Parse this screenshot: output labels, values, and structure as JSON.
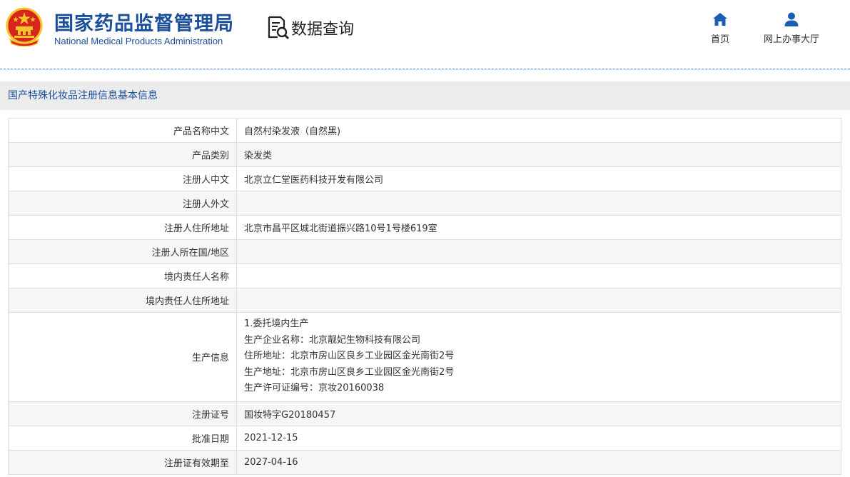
{
  "header": {
    "org_name_cn": "国家药品监督管理局",
    "org_name_en": "National Medical Products Administration",
    "query_label": "数据查询",
    "nav": [
      {
        "label": "首页",
        "icon": "home-icon"
      },
      {
        "label": "网上办事大厅",
        "icon": "user-icon"
      }
    ]
  },
  "section_title": "国产特殊化妆品注册信息基本信息",
  "rows": [
    {
      "label": "产品名称中文",
      "value": "自然村染发液（自然黑)"
    },
    {
      "label": "产品类别",
      "value": "染发类"
    },
    {
      "label": "注册人中文",
      "value": "北京立仁堂医药科技开发有限公司"
    },
    {
      "label": "注册人外文",
      "value": ""
    },
    {
      "label": "注册人住所地址",
      "value": "北京市昌平区城北街道振兴路10号1号楼619室"
    },
    {
      "label": "注册人所在国/地区",
      "value": ""
    },
    {
      "label": "境内责任人名称",
      "value": ""
    },
    {
      "label": "境内责任人住所地址",
      "value": ""
    },
    {
      "label": "生产信息",
      "lines": [
        "1.委托境内生产",
        "生产企业名称：北京靓妃生物科技有限公司",
        "住所地址：北京市房山区良乡工业园区金光南街2号",
        "生产地址：北京市房山区良乡工业园区金光南街2号",
        "生产许可证编号：京妆20160038"
      ]
    },
    {
      "label": "注册证号",
      "value": "国妆特字G20180457"
    },
    {
      "label": "批准日期",
      "value": "2021-12-15"
    },
    {
      "label": "注册证有效期至",
      "value": "2027-04-16"
    }
  ],
  "colors": {
    "brand_blue": "#1a4f9c",
    "emblem_red": "#d7241c",
    "emblem_gold": "#f5c42c",
    "nav_icon_blue": "#1a5fb4"
  }
}
